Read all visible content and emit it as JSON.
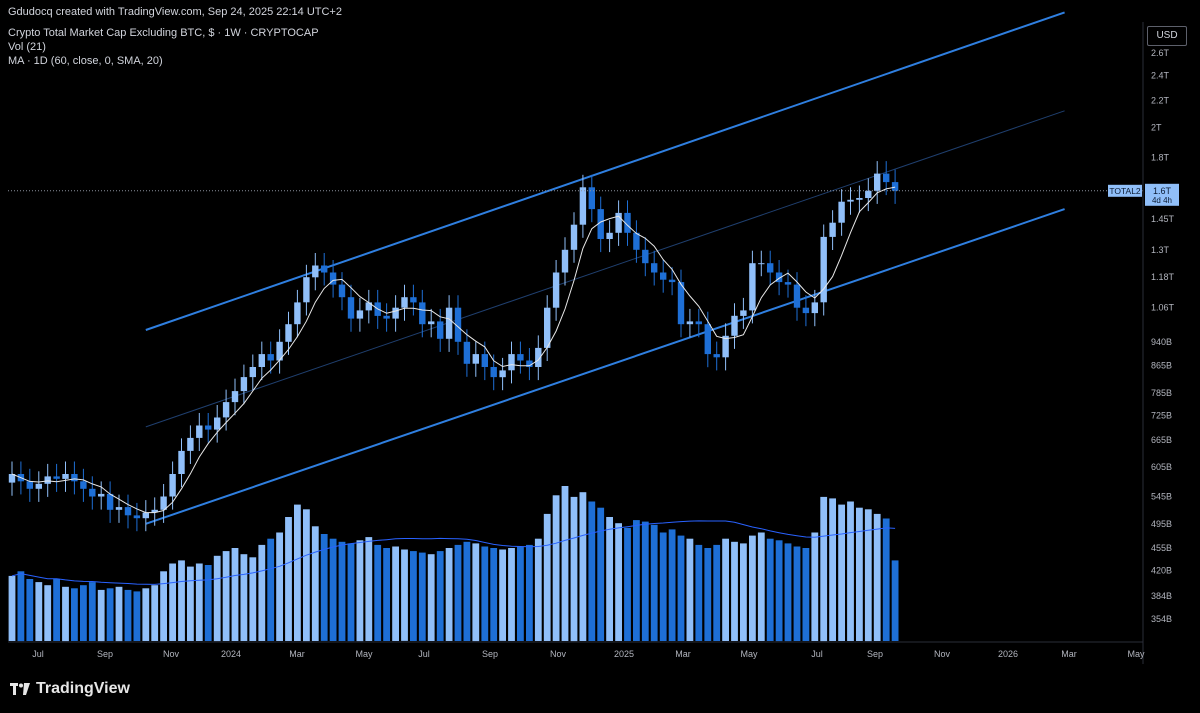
{
  "header": {
    "credit": "Gdudocq created with TradingView.com, Sep 24, 2025 22:14 UTC+2",
    "title": "Crypto Total Market Cap Excluding BTC, $ · 1W · CRYPTOCAP",
    "vol_legend": "Vol (21)",
    "ma_legend": "MA · 1D (60, close, 0, SMA, 20)"
  },
  "price_scale": {
    "currency": "USD",
    "ticks": [
      "2.6T",
      "2.4T",
      "2.2T",
      "2T",
      "1.8T",
      "1.45T",
      "1.3T",
      "1.18T",
      "1.06T",
      "940B",
      "865B",
      "785B",
      "725B",
      "665B",
      "605B",
      "545B",
      "495B",
      "455B",
      "420B",
      "384B",
      "354B"
    ],
    "last_label": {
      "symbol": "TOTAL2",
      "value": "1.6T",
      "countdown": "4d 4h"
    }
  },
  "time_axis": {
    "labels": [
      "Jul",
      "Sep",
      "Nov",
      "2024",
      "Mar",
      "May",
      "Jul",
      "Sep",
      "Nov",
      "2025",
      "Mar",
      "May",
      "Jul",
      "Sep",
      "Nov",
      "2026",
      "Mar",
      "May"
    ]
  },
  "colors": {
    "up": "#90bff9",
    "down": "#1e6fd6",
    "channel": "#2f7fe0",
    "midline": "#1f3f6e",
    "ma": "#e8e8e8",
    "background": "#000000"
  },
  "chart_data": {
    "type": "candlestick",
    "title": "Crypto Total Market Cap Excluding BTC, $ · 1W · CRYPTOCAP",
    "series_unit": "USD",
    "log_scale": true,
    "interval": "1W",
    "x_range": [
      "2023-06",
      "2026-05"
    ],
    "ylim": [
      354000000000,
      2600000000000
    ],
    "last_value": "1.6T",
    "close": [
      590,
      575,
      560,
      570,
      585,
      580,
      590,
      575,
      560,
      545,
      550,
      520,
      525,
      510,
      505,
      515,
      520,
      545,
      590,
      640,
      670,
      700,
      690,
      720,
      760,
      790,
      830,
      860,
      900,
      880,
      940,
      1000,
      1080,
      1180,
      1230,
      1200,
      1150,
      1100,
      1020,
      1050,
      1080,
      1030,
      1020,
      1060,
      1100,
      1080,
      1000,
      1010,
      950,
      1060,
      940,
      870,
      900,
      860,
      830,
      850,
      900,
      880,
      860,
      920,
      1060,
      1200,
      1300,
      1420,
      1620,
      1500,
      1350,
      1380,
      1480,
      1380,
      1300,
      1240,
      1200,
      1170,
      1160,
      1000,
      1010,
      1000,
      900,
      890,
      960,
      1030,
      1050,
      1240,
      1240,
      1200,
      1160,
      1150,
      1060,
      1040,
      1080,
      1360,
      1430,
      1540,
      1550,
      1560,
      1600,
      1700,
      1650,
      1600
    ],
    "volume_relative": [
      0.42,
      0.45,
      0.4,
      0.38,
      0.36,
      0.4,
      0.35,
      0.34,
      0.36,
      0.38,
      0.33,
      0.34,
      0.35,
      0.33,
      0.32,
      0.34,
      0.36,
      0.45,
      0.5,
      0.52,
      0.48,
      0.5,
      0.49,
      0.55,
      0.58,
      0.6,
      0.56,
      0.54,
      0.62,
      0.66,
      0.7,
      0.8,
      0.88,
      0.85,
      0.74,
      0.69,
      0.66,
      0.64,
      0.63,
      0.65,
      0.67,
      0.62,
      0.6,
      0.61,
      0.59,
      0.58,
      0.57,
      0.56,
      0.58,
      0.6,
      0.62,
      0.64,
      0.63,
      0.61,
      0.6,
      0.59,
      0.6,
      0.61,
      0.62,
      0.66,
      0.82,
      0.94,
      1.0,
      0.93,
      0.96,
      0.9,
      0.86,
      0.8,
      0.76,
      0.73,
      0.78,
      0.77,
      0.75,
      0.7,
      0.72,
      0.68,
      0.66,
      0.62,
      0.6,
      0.62,
      0.66,
      0.64,
      0.63,
      0.68,
      0.7,
      0.66,
      0.65,
      0.63,
      0.61,
      0.6,
      0.7,
      0.93,
      0.92,
      0.88,
      0.9,
      0.86,
      0.85,
      0.82,
      0.79,
      0.52
    ],
    "moving_average": {
      "label": "MA · 1D (60, close, 0, SMA, 20)"
    },
    "channel": {
      "upper_start": 980,
      "upper_end": 3000,
      "lower_start": 495,
      "lower_end": 1500
    },
    "grid": false,
    "legend": "top-left"
  }
}
